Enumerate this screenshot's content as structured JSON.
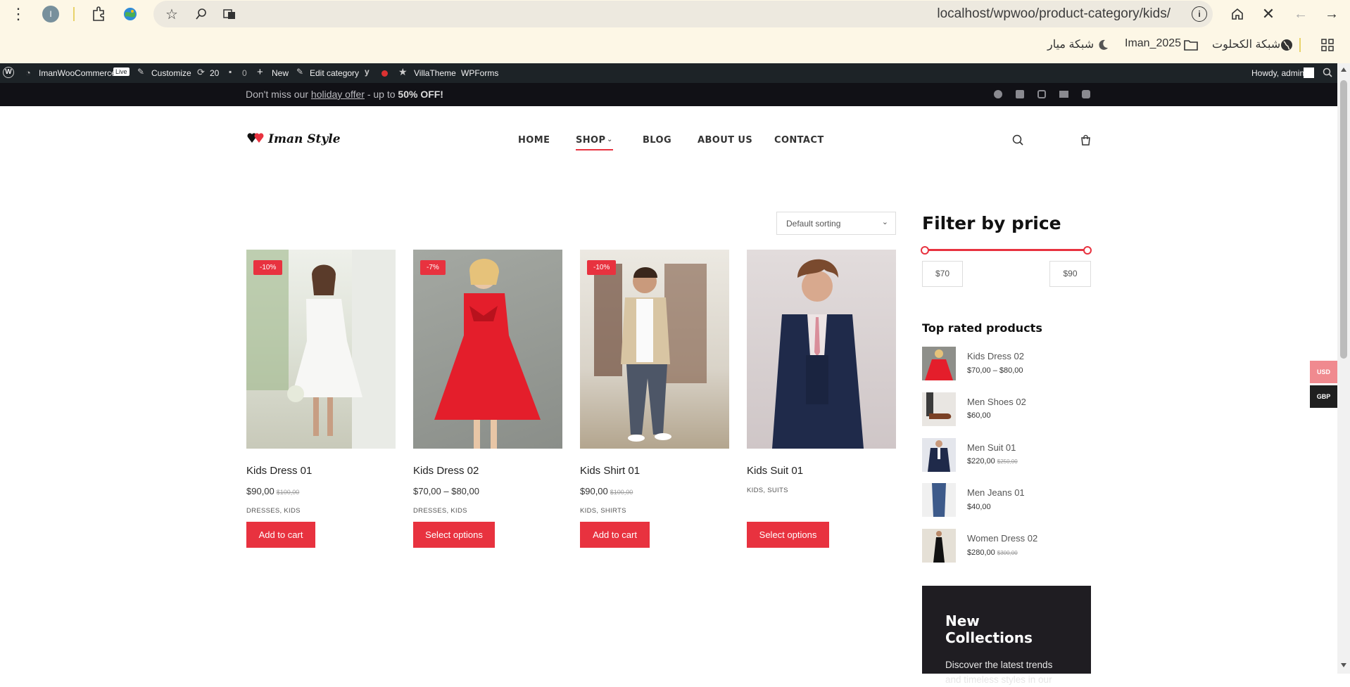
{
  "browser": {
    "url": "localhost/wpwoo/product-category/kids/",
    "profile_initial": "I",
    "bookmarks": [
      "شبكة الكحلوت",
      "Iman_2025",
      "شبكة ميار"
    ]
  },
  "admin_bar": {
    "site": "ImanWooCommerce",
    "live": "Live",
    "customize": "Customize",
    "updates": "20",
    "comments": "0",
    "new": "New",
    "edit_category": "Edit category",
    "villatheme": "VillaTheme",
    "wpforms": "WPForms",
    "howdy": "Howdy, admin"
  },
  "notice": {
    "prefix": "Don't miss our ",
    "link": "holiday offer",
    "middle": " - up to ",
    "bold": "50% OFF!"
  },
  "header": {
    "logo": "Iman Style",
    "nav": [
      "HOME",
      "SHOP",
      "BLOG",
      "ABOUT US",
      "CONTACT"
    ]
  },
  "sorting": {
    "selected": "Default sorting"
  },
  "products": [
    {
      "name": "Kids Dress 01",
      "badge": "-10%",
      "price": "$90,00",
      "old_price": "$100,00",
      "cats": "DRESSES, KIDS",
      "button": "Add to cart"
    },
    {
      "name": "Kids Dress 02",
      "badge": "-7%",
      "price": "$70,00 – $80,00",
      "old_price": "",
      "cats": "DRESSES, KIDS",
      "button": "Select options"
    },
    {
      "name": "Kids Shirt 01",
      "badge": "-10%",
      "price": "$90,00",
      "old_price": "$100,00",
      "cats": "KIDS, SHIRTS",
      "button": "Add to cart"
    },
    {
      "name": "Kids Suit 01",
      "badge": "",
      "price": "",
      "old_price": "",
      "cats": "KIDS, SUITS",
      "button": "Select options"
    }
  ],
  "sidebar": {
    "filter_title": "Filter by price",
    "min": "$70",
    "max": "$90",
    "top_rated_title": "Top rated products",
    "top_rated": [
      {
        "name": "Kids Dress 02",
        "price": "$70,00 – $80,00",
        "old_price": ""
      },
      {
        "name": "Men Shoes 02",
        "price": "$60,00",
        "old_price": ""
      },
      {
        "name": "Men Suit 01",
        "price": "$220,00",
        "old_price": "$250,00"
      },
      {
        "name": "Men Jeans 01",
        "price": "$40,00",
        "old_price": ""
      },
      {
        "name": "Women Dress 02",
        "price": "$280,00",
        "old_price": "$300,00"
      }
    ],
    "promo_title": "New Collections",
    "promo_text": "Discover the latest trends and timeless styles in our"
  },
  "currency": [
    "USD",
    "GBP"
  ],
  "colors": {
    "accent": "#e8323f",
    "dark": "#1d2327"
  }
}
